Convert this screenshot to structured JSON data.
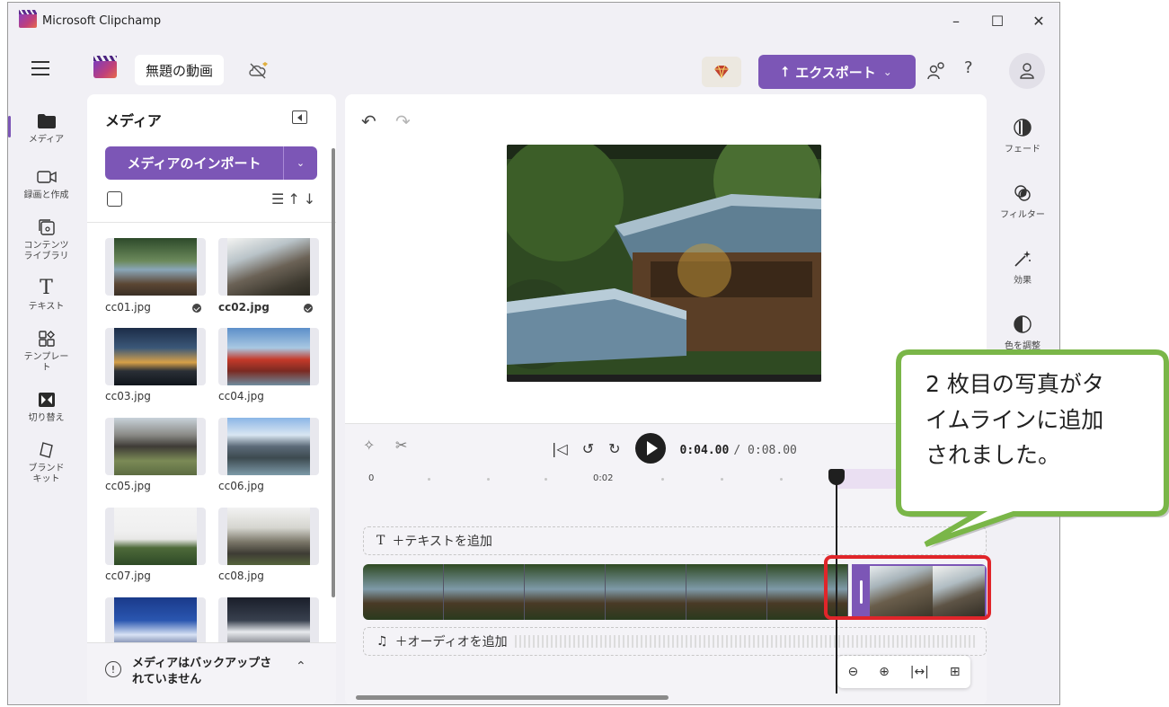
{
  "window": {
    "title": "Microsoft Clipchamp",
    "controls": [
      "–",
      "☐",
      "✕"
    ]
  },
  "topbar": {
    "project_title": "無題の動画",
    "export_label": "エクスポート",
    "export_chevron": "⌄",
    "help_label": "?"
  },
  "left_nav": [
    {
      "label": "メディア",
      "icon": "folder-icon"
    },
    {
      "label": "録画と作成",
      "icon": "camera-icon"
    },
    {
      "label": "コンテンツ\nライブラリ",
      "icon": "content-library-icon"
    },
    {
      "label": "テキスト",
      "icon": "text-icon"
    },
    {
      "label": "テンプレー\nト",
      "icon": "template-icon"
    },
    {
      "label": "切り替え",
      "icon": "transition-icon"
    },
    {
      "label": "ブランド\nキット",
      "icon": "brand-kit-icon"
    }
  ],
  "media_panel": {
    "title": "メディア",
    "import_label": "メディアのインポート",
    "items": [
      {
        "name": "cc01.jpg",
        "added": true
      },
      {
        "name": "cc02.jpg",
        "added": true
      },
      {
        "name": "cc03.jpg",
        "added": false
      },
      {
        "name": "cc04.jpg",
        "added": false
      },
      {
        "name": "cc05.jpg",
        "added": false
      },
      {
        "name": "cc06.jpg",
        "added": false
      },
      {
        "name": "cc07.jpg",
        "added": false
      },
      {
        "name": "cc08.jpg",
        "added": false
      }
    ],
    "backup_notice": "メディアはバックアップされていません"
  },
  "timeline": {
    "current_time": "0:04.00",
    "total_time": "/ 0:08.00",
    "ruler_labels": [
      "0",
      "0:02",
      "0"
    ],
    "text_track_label": "＋テキストを追加",
    "audio_track_label": "＋オーディオを追加"
  },
  "right_nav": [
    {
      "label": "フェード",
      "icon": "fade-icon"
    },
    {
      "label": "フィルター",
      "icon": "filter-icon"
    },
    {
      "label": "効果",
      "icon": "effects-icon"
    },
    {
      "label": "色を調整",
      "icon": "color-adjust-icon"
    }
  ],
  "callout": {
    "lines": [
      "2 枚目の写真がタ",
      "イムラインに追加",
      "されました。"
    ]
  },
  "colors": {
    "accent": "#7c56b6",
    "highlight": "#e0252a",
    "callout_fill": "#ffffff",
    "callout_border": "#7ab648"
  }
}
